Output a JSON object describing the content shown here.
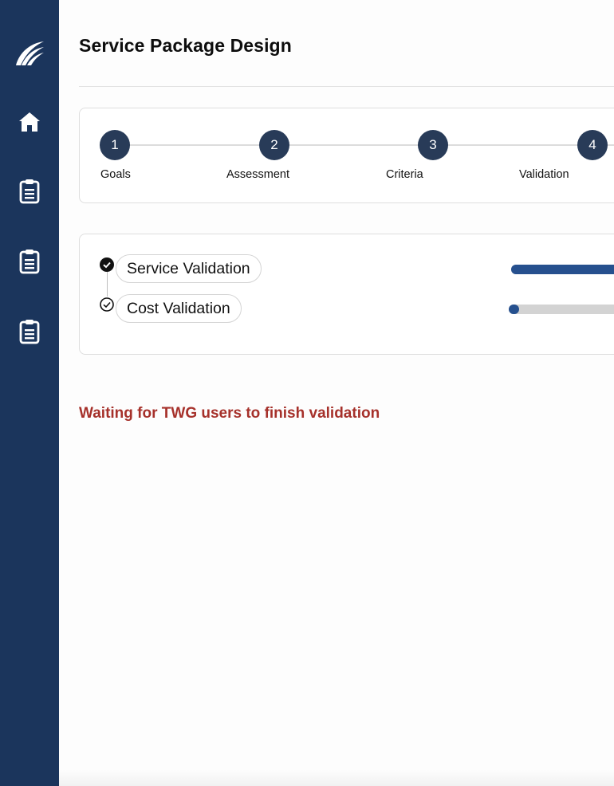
{
  "header": {
    "title": "Service Package Design"
  },
  "sidebar": {
    "items": [
      {
        "icon": "logo-wings-icon"
      },
      {
        "icon": "home-icon"
      },
      {
        "icon": "clipboard-icon"
      },
      {
        "icon": "clipboard-icon"
      },
      {
        "icon": "clipboard-icon"
      }
    ]
  },
  "stepper": {
    "steps": [
      {
        "number": "1",
        "label": "Goals"
      },
      {
        "number": "2",
        "label": "Assessment"
      },
      {
        "number": "3",
        "label": "Criteria"
      },
      {
        "number": "4",
        "label": "Validation"
      }
    ]
  },
  "validations": [
    {
      "label": "Service Validation",
      "status": "complete",
      "progress_percent": 100
    },
    {
      "label": "Cost Validation",
      "status": "pending",
      "progress_percent": 5
    }
  ],
  "status_message": "Waiting for TWG users to finish validation",
  "colors": {
    "sidebar_bg": "#1b355c",
    "step_circle": "#283b58",
    "progress_fill": "#26508e",
    "progress_track": "#d3d3d3",
    "warning_text": "#a6312b"
  }
}
